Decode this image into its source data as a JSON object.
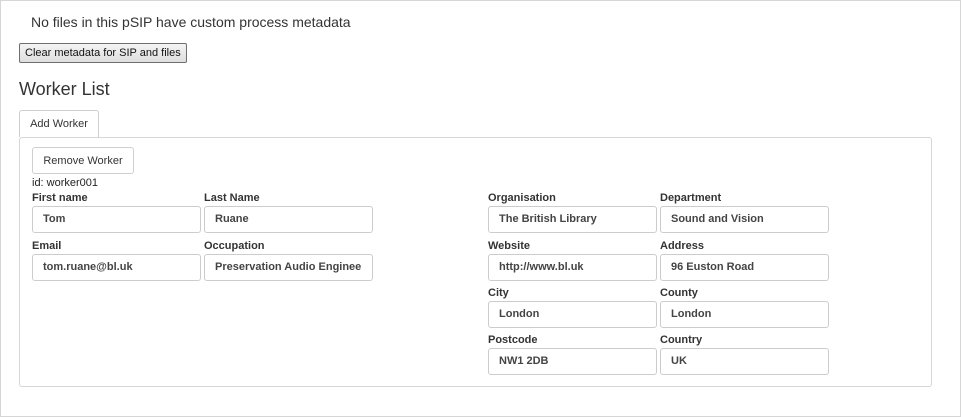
{
  "notice": "No files in this pSIP have custom process metadata",
  "clear_button": "Clear metadata for SIP and files",
  "section_title": "Worker List",
  "add_worker_button": "Add Worker",
  "worker": {
    "remove_button": "Remove Worker",
    "id_text": "id: worker001",
    "fields": {
      "first_name": {
        "label": "First name",
        "value": "Tom"
      },
      "last_name": {
        "label": "Last Name",
        "value": "Ruane"
      },
      "email": {
        "label": "Email",
        "value": "tom.ruane@bl.uk"
      },
      "occupation": {
        "label": "Occupation",
        "value": "Preservation Audio Enginee"
      },
      "organisation": {
        "label": "Organisation",
        "value": "The British Library"
      },
      "department": {
        "label": "Department",
        "value": "Sound and Vision"
      },
      "website": {
        "label": "Website",
        "value": "http://www.bl.uk"
      },
      "address": {
        "label": "Address",
        "value": "96 Euston Road"
      },
      "city": {
        "label": "City",
        "value": "London"
      },
      "county": {
        "label": "County",
        "value": "London"
      },
      "postcode": {
        "label": "Postcode",
        "value": "NW1 2DB"
      },
      "country": {
        "label": "Country",
        "value": "UK"
      }
    }
  }
}
